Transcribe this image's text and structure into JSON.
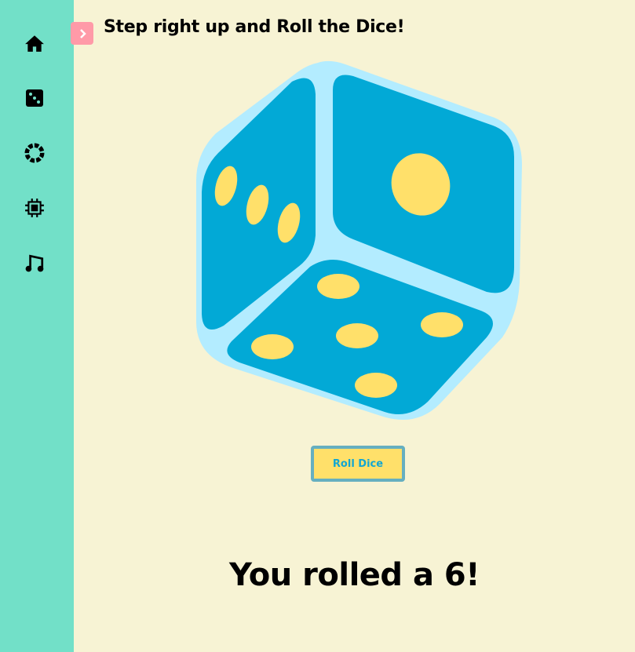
{
  "sidebar": {
    "items": [
      {
        "icon": "home-icon"
      },
      {
        "icon": "dice-icon"
      },
      {
        "icon": "wheel-icon"
      },
      {
        "icon": "chip-icon"
      },
      {
        "icon": "music-icon"
      }
    ]
  },
  "header": {
    "toggle_icon": "chevron-right-icon",
    "title": "Step right up and Roll the Dice!"
  },
  "dice": {
    "faces_shown": [
      3,
      1,
      5
    ]
  },
  "roll_button": {
    "label": "Roll Dice"
  },
  "result": {
    "text": "You rolled a 6!"
  },
  "colors": {
    "sidebar": "#72e0c8",
    "background": "#f7f3d4",
    "dice_face": "#02a9d6",
    "dice_edge": "#b3ecff",
    "pips": "#ffe06a",
    "toggle": "#ff9aa8"
  }
}
